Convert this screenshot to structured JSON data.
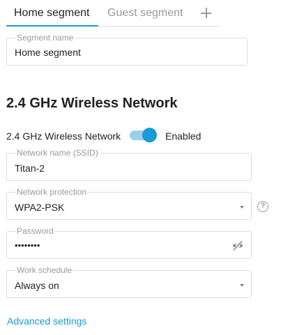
{
  "tabs": {
    "items": [
      {
        "label": "Home segment",
        "active": true
      },
      {
        "label": "Guest segment",
        "active": false
      }
    ],
    "add_icon": "plus-icon"
  },
  "segment": {
    "label": "Segment name",
    "value": "Home segment"
  },
  "section": {
    "title": "2.4 GHz Wireless Network"
  },
  "wireless": {
    "label": "2.4 GHz Wireless Network",
    "enabled": true,
    "state_label": "Enabled"
  },
  "ssid": {
    "label": "Network name (SSID)",
    "value": "Titan-2"
  },
  "protection": {
    "label": "Network protection",
    "value": "WPA2-PSK",
    "help_icon": "question-circle-icon",
    "help_glyph": "?"
  },
  "password": {
    "label": "Password",
    "value": "••••••••",
    "visibility_icon": "eye-off-icon"
  },
  "schedule": {
    "label": "Work schedule",
    "value": "Always on"
  },
  "advanced": {
    "label": "Advanced settings"
  },
  "colors": {
    "accent": "#1a9ad6",
    "accent_light": "#9cd0ea",
    "muted": "#9a9a9a",
    "border": "#dddddd"
  }
}
